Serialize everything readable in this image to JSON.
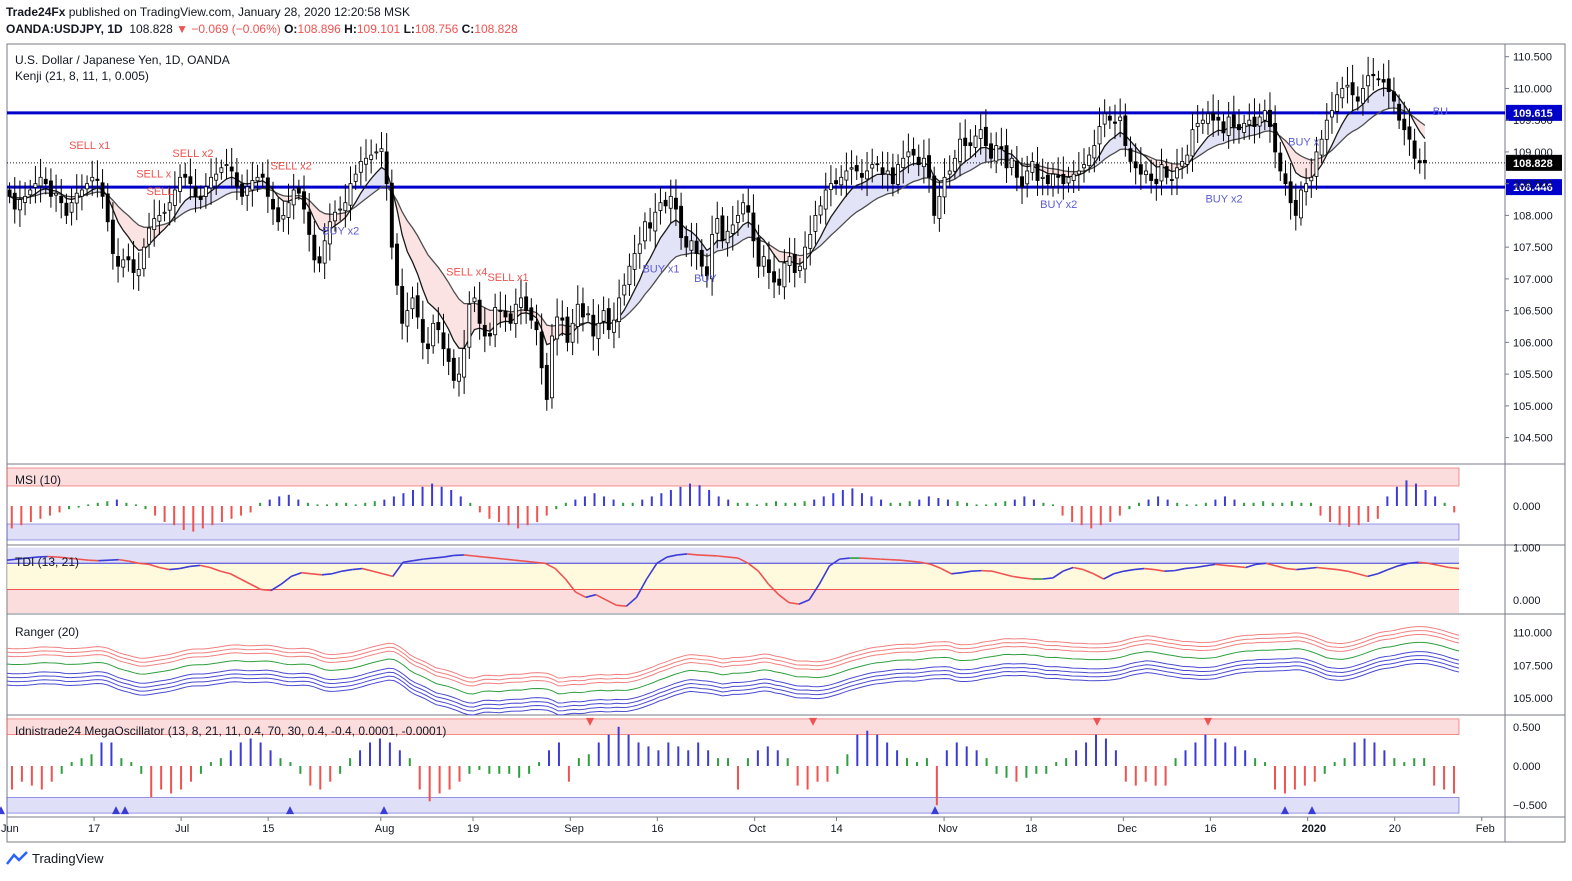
{
  "header": {
    "author": "Trade24Fx",
    "published": "published on TradingView.com, January 28, 2020 12:20:58 MSK"
  },
  "ohlc": {
    "symbol": "OANDA:USDJPY, 1D",
    "last": "108.828",
    "arrow": "▼",
    "change": "−0.069 (−0.06%)",
    "o_label": "O:",
    "o": "108.896",
    "h_label": "H:",
    "h": "109.101",
    "l_label": "L:",
    "l": "108.756",
    "c_label": "C:",
    "c": "108.828"
  },
  "footer": {
    "brand": "TradingView"
  },
  "colors": {
    "up": "#ffffff",
    "down": "#000000",
    "level": "#0000cc",
    "buy": "#5b5bd6",
    "sell": "#ef5350",
    "green": "#2e9e3e"
  },
  "chart_data": [
    {
      "type": "candlestick",
      "title": "U.S. Dollar / Japanese Yen, 1D, OANDA",
      "indicator": "Kenji (21, 8, 11, 1, 0.005)",
      "ylim": [
        104.1,
        110.7
      ],
      "yticks": [
        "110.500",
        "110.000",
        "109.500",
        "109.000",
        "108.500",
        "108.000",
        "107.500",
        "107.000",
        "106.500",
        "106.000",
        "105.500",
        "105.000",
        "104.500"
      ],
      "ytick_values": [
        110.5,
        110.0,
        109.5,
        109.0,
        108.5,
        108.0,
        107.5,
        107.0,
        106.5,
        106.0,
        105.5,
        105.0,
        104.5
      ],
      "levels": [
        {
          "label": "109.615",
          "value": 109.615
        },
        {
          "label": "108.446",
          "value": 108.446
        }
      ],
      "last_price": {
        "label": "108.828",
        "value": 108.828
      },
      "xlabels": [
        "Jun",
        "17",
        "Jul",
        "15",
        "Aug",
        "19",
        "Sep",
        "16",
        "Oct",
        "14",
        "Nov",
        "18",
        "Dec",
        "16",
        "2020",
        "20",
        "Feb"
      ],
      "xlabel_index": [
        0,
        17,
        34,
        51,
        73,
        91,
        110,
        127,
        146,
        162,
        183,
        200,
        218,
        235,
        254,
        271,
        288
      ],
      "annotations": [
        {
          "text": "SELL x1",
          "i": 15,
          "y": 109.05
        },
        {
          "text": "SELL x2",
          "i": 35,
          "y": 108.92
        },
        {
          "text": "SELL x",
          "i": 28,
          "y": 108.6
        },
        {
          "text": "SELL",
          "i": 30,
          "y": 108.32
        },
        {
          "text": "SELL x2",
          "i": 54,
          "y": 108.72
        },
        {
          "text": "SELL x4",
          "i": 88,
          "y": 107.05
        },
        {
          "text": "SELL x1",
          "i": 96,
          "y": 106.97
        },
        {
          "text": "BUY x2",
          "i": 64,
          "y": 107.7
        },
        {
          "text": "BUY x1",
          "i": 126,
          "y": 107.1
        },
        {
          "text": "BUY",
          "i": 136,
          "y": 106.95
        },
        {
          "text": "BUY x2",
          "i": 203,
          "y": 108.12
        },
        {
          "text": "BUY x2",
          "i": 235,
          "y": 108.2
        },
        {
          "text": "BUY x",
          "i": 251,
          "y": 109.1
        },
        {
          "text": "BU",
          "i": 279,
          "y": 109.58
        }
      ],
      "closes": [
        108.3,
        108.1,
        108.25,
        108.3,
        108.4,
        108.5,
        108.6,
        108.5,
        108.3,
        108.35,
        108.2,
        108.0,
        108.2,
        108.35,
        108.4,
        108.5,
        108.6,
        108.55,
        108.3,
        107.9,
        107.4,
        107.2,
        107.3,
        107.3,
        107.1,
        107.15,
        107.5,
        107.8,
        107.95,
        108.0,
        108.05,
        108.2,
        108.4,
        108.6,
        108.6,
        108.5,
        108.3,
        108.25,
        108.45,
        108.6,
        108.65,
        108.75,
        108.8,
        108.7,
        108.45,
        108.3,
        108.45,
        108.55,
        108.6,
        108.6,
        108.3,
        108.1,
        107.9,
        108.0,
        108.2,
        108.4,
        108.35,
        108.1,
        107.7,
        107.3,
        107.25,
        107.6,
        107.9,
        108.05,
        108.1,
        108.2,
        108.5,
        108.65,
        108.85,
        108.9,
        108.95,
        109.0,
        109.05,
        108.5,
        107.5,
        106.9,
        106.3,
        106.5,
        106.7,
        106.4,
        106.0,
        105.9,
        106.3,
        106.2,
        105.9,
        105.7,
        105.4,
        105.5,
        105.9,
        106.6,
        106.7,
        106.3,
        106.1,
        106.1,
        106.55,
        106.5,
        106.4,
        106.3,
        106.6,
        106.7,
        106.5,
        106.35,
        106.2,
        105.6,
        105.1,
        106.1,
        106.4,
        106.35,
        106.0,
        106.3,
        106.6,
        106.4,
        106.45,
        106.1,
        106.3,
        106.5,
        106.2,
        106.35,
        106.7,
        106.9,
        107.2,
        107.4,
        107.55,
        107.9,
        107.8,
        108.05,
        108.2,
        108.15,
        108.3,
        108.1,
        107.65,
        107.5,
        107.6,
        107.4,
        107.2,
        107.05,
        107.7,
        107.95,
        107.6,
        107.75,
        107.85,
        108.0,
        108.2,
        108.05,
        107.6,
        107.2,
        107.35,
        107.1,
        106.95,
        106.9,
        107.25,
        107.35,
        107.1,
        107.2,
        107.5,
        107.7,
        108.0,
        108.15,
        108.4,
        108.5,
        108.5,
        108.6,
        108.7,
        108.75,
        108.7,
        108.6,
        108.7,
        108.8,
        108.8,
        108.65,
        108.7,
        108.5,
        108.8,
        108.9,
        109.0,
        108.95,
        108.8,
        108.9,
        108.6,
        108.0,
        108.3,
        108.6,
        108.7,
        108.9,
        109.2,
        109.1,
        109.1,
        109.25,
        109.35,
        109.1,
        108.9,
        109.1,
        109.05,
        108.75,
        108.9,
        108.6,
        108.45,
        108.7,
        108.85,
        108.55,
        108.6,
        108.5,
        108.65,
        108.6,
        108.5,
        108.6,
        108.65,
        108.7,
        108.8,
        108.95,
        109.1,
        109.4,
        109.6,
        109.5,
        109.45,
        109.55,
        109.1,
        108.85,
        108.75,
        108.65,
        108.7,
        108.55,
        108.5,
        108.8,
        108.6,
        108.55,
        108.75,
        108.85,
        108.95,
        109.35,
        109.45,
        109.5,
        109.6,
        109.5,
        109.5,
        109.3,
        109.55,
        109.4,
        109.35,
        109.45,
        109.5,
        109.4,
        109.55,
        109.65,
        109.4,
        109.0,
        108.7,
        108.5,
        108.2,
        108.0,
        108.4,
        108.5,
        108.6,
        109.0,
        109.2,
        109.5,
        109.65,
        109.9,
        110.0,
        110.05,
        109.9,
        109.8,
        110.0,
        110.2,
        110.2,
        110.15,
        110.1,
        109.95,
        109.8,
        109.5,
        109.35,
        109.2,
        108.9,
        108.83,
        108.83
      ]
    },
    {
      "type": "histogram",
      "title": "MSI (10)",
      "yticks": [
        "0.000"
      ],
      "values": [
        -0.7,
        -0.6,
        -0.5,
        -0.4,
        -0.3,
        -0.2,
        -0.1,
        -0.05,
        0.05,
        0.1,
        0.15,
        0.2,
        0.1,
        0.05,
        -0.1,
        -0.3,
        -0.5,
        -0.6,
        -0.75,
        -0.8,
        -0.7,
        -0.6,
        -0.5,
        -0.4,
        -0.3,
        -0.2,
        0.1,
        0.2,
        0.3,
        0.35,
        0.2,
        0.1,
        0.05,
        0.05,
        0.1,
        0.1,
        0.05,
        0.1,
        0.15,
        0.2,
        0.3,
        0.4,
        0.5,
        0.6,
        0.7,
        0.6,
        0.5,
        0.3,
        0.1,
        -0.2,
        -0.4,
        -0.5,
        -0.6,
        -0.7,
        -0.6,
        -0.5,
        -0.3,
        -0.1,
        0.1,
        0.2,
        0.3,
        0.4,
        0.3,
        0.2,
        0.1,
        0.1,
        0.2,
        0.3,
        0.4,
        0.5,
        0.6,
        0.7,
        0.65,
        0.5,
        0.3,
        0.2,
        0.1,
        0.1,
        0.05,
        0.1,
        0.15,
        0.1,
        0.1,
        0.15,
        0.2,
        0.3,
        0.4,
        0.5,
        0.55,
        0.4,
        0.3,
        0.2,
        0.1,
        0.1,
        0.15,
        0.2,
        0.3,
        0.25,
        0.2,
        0.15,
        0.1,
        0.05,
        0.05,
        0.1,
        0.15,
        0.2,
        0.3,
        0.2,
        0.1,
        0.05,
        -0.3,
        -0.5,
        -0.6,
        -0.7,
        -0.6,
        -0.5,
        -0.3,
        -0.1,
        0.1,
        0.2,
        0.3,
        0.2,
        0.1,
        0.05,
        0.05,
        0.1,
        0.2,
        0.3,
        0.2,
        0.1,
        0.1,
        0.15,
        0.1,
        0.1,
        0.15,
        0.1,
        0.1,
        -0.3,
        -0.5,
        -0.6,
        -0.65,
        -0.6,
        -0.5,
        -0.4,
        0.3,
        0.6,
        0.8,
        0.7,
        0.5,
        0.3,
        0.1,
        -0.2
      ]
    },
    {
      "type": "line",
      "title": "TDI (13, 21)",
      "yticks": [
        "1.000",
        "0.000"
      ],
      "ytick_values": [
        1.0,
        0.0
      ],
      "ylim": [
        -0.25,
        1.05
      ],
      "bands": [
        0.7,
        0.2
      ],
      "values": [
        0.76,
        0.78,
        0.8,
        0.82,
        0.83,
        0.82,
        0.8,
        0.78,
        0.76,
        0.75,
        0.76,
        0.77,
        0.74,
        0.7,
        0.68,
        0.62,
        0.58,
        0.6,
        0.64,
        0.66,
        0.62,
        0.55,
        0.5,
        0.4,
        0.3,
        0.2,
        0.18,
        0.3,
        0.45,
        0.52,
        0.5,
        0.48,
        0.5,
        0.55,
        0.58,
        0.6,
        0.55,
        0.5,
        0.45,
        0.72,
        0.75,
        0.78,
        0.8,
        0.82,
        0.85,
        0.86,
        0.84,
        0.82,
        0.8,
        0.78,
        0.76,
        0.74,
        0.72,
        0.7,
        0.6,
        0.4,
        0.15,
        0.05,
        0.1,
        0.0,
        -0.1,
        -0.12,
        0.05,
        0.4,
        0.7,
        0.82,
        0.86,
        0.88,
        0.86,
        0.85,
        0.84,
        0.82,
        0.8,
        0.7,
        0.55,
        0.3,
        0.1,
        -0.05,
        -0.08,
        0.0,
        0.3,
        0.65,
        0.78,
        0.8,
        0.8,
        0.79,
        0.78,
        0.77,
        0.76,
        0.74,
        0.72,
        0.68,
        0.6,
        0.5,
        0.52,
        0.55,
        0.56,
        0.55,
        0.5,
        0.45,
        0.42,
        0.4,
        0.4,
        0.42,
        0.55,
        0.62,
        0.58,
        0.5,
        0.4,
        0.5,
        0.55,
        0.58,
        0.6,
        0.58,
        0.55,
        0.56,
        0.6,
        0.62,
        0.65,
        0.68,
        0.66,
        0.64,
        0.62,
        0.68,
        0.7,
        0.65,
        0.6,
        0.58,
        0.6,
        0.62,
        0.6,
        0.58,
        0.55,
        0.5,
        0.45,
        0.5,
        0.58,
        0.65,
        0.7,
        0.72,
        0.7,
        0.66,
        0.62,
        0.6
      ]
    },
    {
      "type": "line",
      "title": "Ranger (20)",
      "yticks": [
        "110.000",
        "107.500",
        "105.000"
      ],
      "ytick_values": [
        110.0,
        107.5,
        105.0
      ],
      "ylim": [
        103.8,
        111.4
      ]
    },
    {
      "type": "histogram",
      "title": "Idnistrade24 MegaOscillator (13, 8, 21, 11, 0.4, 70, 30, 0.4, -0.4, 0.0001, -0.0001)",
      "yticks": [
        "0.500",
        "0.000",
        "−0.500"
      ],
      "ytick_values": [
        0.5,
        0.0,
        -0.5
      ],
      "ylim": [
        -0.65,
        0.65
      ],
      "bands": [
        0.4,
        -0.4
      ],
      "values": [
        -0.3,
        -0.2,
        -0.25,
        -0.3,
        -0.2,
        -0.1,
        0.05,
        0.1,
        0.15,
        0.3,
        0.3,
        0.1,
        0.05,
        -0.1,
        -0.4,
        -0.3,
        -0.35,
        -0.3,
        -0.2,
        -0.1,
        0.05,
        0.1,
        0.2,
        0.3,
        0.35,
        0.3,
        0.2,
        0.1,
        0.05,
        -0.1,
        -0.25,
        -0.3,
        -0.2,
        -0.1,
        0.1,
        0.2,
        0.3,
        0.35,
        0.3,
        0.2,
        0.1,
        -0.3,
        -0.45,
        -0.35,
        -0.3,
        -0.2,
        -0.1,
        -0.05,
        -0.1,
        -0.1,
        -0.1,
        -0.15,
        -0.1,
        0.05,
        0.2,
        0.3,
        -0.2,
        0.1,
        0.15,
        0.3,
        0.4,
        0.5,
        0.4,
        0.3,
        0.25,
        0.2,
        0.3,
        0.25,
        0.2,
        0.3,
        0.2,
        0.1,
        0.1,
        -0.3,
        0.1,
        0.2,
        0.25,
        0.2,
        0.1,
        -0.25,
        -0.3,
        -0.2,
        -0.2,
        -0.1,
        0.15,
        0.4,
        0.45,
        0.4,
        0.3,
        0.2,
        0.1,
        0.05,
        0.1,
        -0.5,
        0.2,
        0.3,
        0.25,
        0.2,
        0.1,
        -0.1,
        -0.15,
        -0.2,
        -0.15,
        -0.1,
        -0.1,
        0.05,
        0.1,
        0.2,
        0.3,
        0.4,
        0.35,
        0.2,
        -0.2,
        -0.25,
        -0.2,
        -0.25,
        -0.25,
        0.1,
        0.2,
        0.3,
        0.4,
        0.35,
        0.3,
        0.25,
        0.2,
        0.1,
        0.05,
        -0.3,
        -0.35,
        -0.3,
        -0.25,
        -0.2,
        -0.1,
        0.05,
        0.1,
        0.3,
        0.35,
        0.3,
        0.2,
        0.1,
        0.05,
        0.1,
        0.1,
        -0.25,
        -0.3,
        -0.35
      ],
      "up_markers": [
        1,
        116,
        125,
        290,
        384,
        935,
        1285,
        1312
      ],
      "down_markers": [
        590,
        813,
        1097,
        1208
      ]
    }
  ]
}
